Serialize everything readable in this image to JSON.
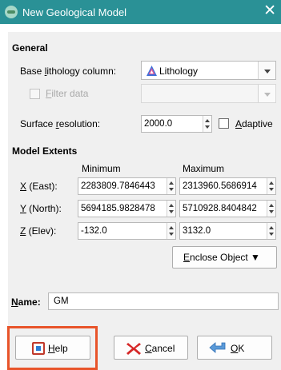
{
  "window": {
    "title": "New Geological Model",
    "close_glyph": "✕"
  },
  "general": {
    "header": "General",
    "base_lithology_label": "Base ",
    "base_lithology_label_u": "l",
    "base_lithology_label_rest": "ithology column:",
    "base_lithology_value": "Lithology",
    "filter_data_label_u": "F",
    "filter_data_label_rest": "ilter data",
    "surface_resolution_label": "Surface ",
    "surface_resolution_label_u": "r",
    "surface_resolution_label_rest": "esolution:",
    "surface_resolution_value": "2000.0",
    "adaptive_label_u": "A",
    "adaptive_label_rest": "daptive"
  },
  "extents": {
    "header": "Model Extents",
    "col_min": "Minimum",
    "col_max": "Maximum",
    "rows": [
      {
        "label_u": "X",
        "label_rest": " (East):",
        "min": "2283809.7846443",
        "max": "2313960.5686914"
      },
      {
        "label_u": "Y",
        "label_rest": " (North):",
        "min": "5694185.9828478",
        "max": "5710928.8404842"
      },
      {
        "label_u": "Z",
        "label_rest": " (Elev):",
        "min": "-132.0",
        "max": "3132.0"
      }
    ],
    "enclose_label_u": "E",
    "enclose_label_rest": "nclose Object ▼"
  },
  "name": {
    "label_u": "N",
    "label_rest": "ame:",
    "value": "GM"
  },
  "buttons": {
    "help_u": "H",
    "help_rest": "elp",
    "cancel_u": "C",
    "cancel_rest": "ancel",
    "ok_u": "O",
    "ok_rest": "K"
  },
  "colors": {
    "titlebar": "#2a9196",
    "panel": "#f0f0f0",
    "highlight": "#e8542a"
  }
}
